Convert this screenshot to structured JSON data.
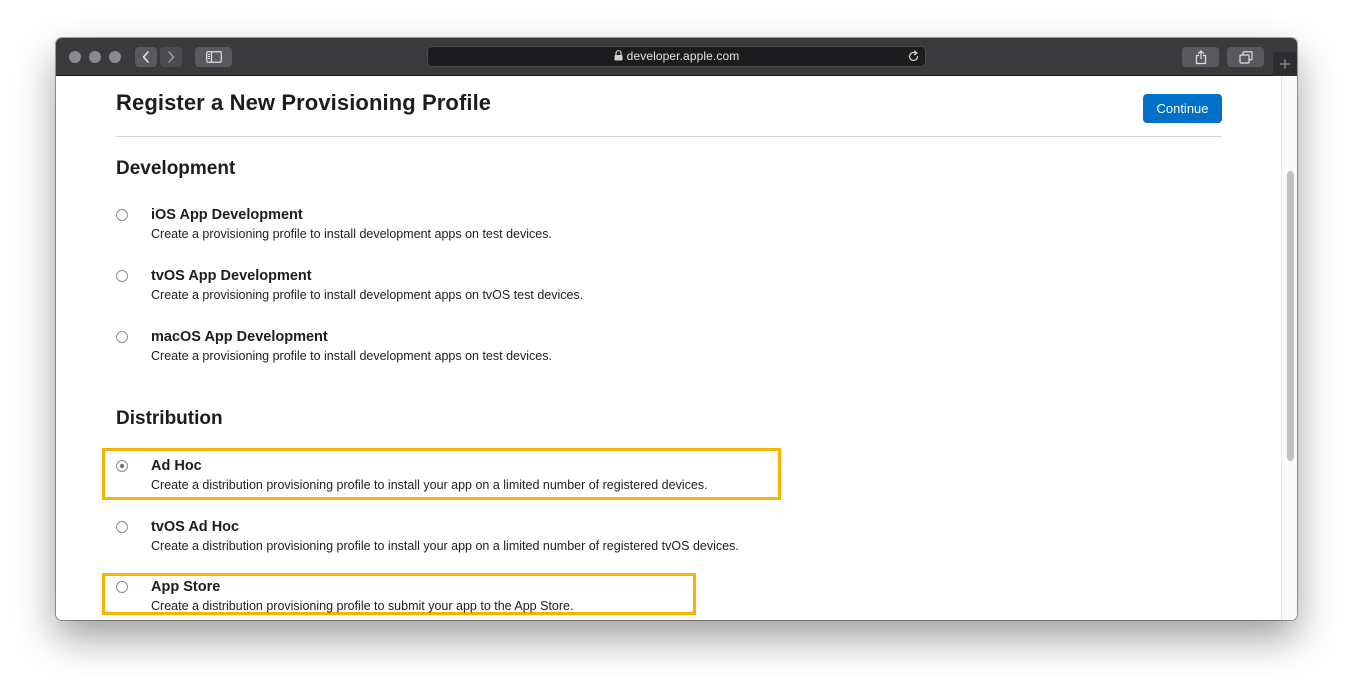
{
  "browser": {
    "address": "developer.apple.com"
  },
  "page": {
    "title": "Register a New Provisioning Profile",
    "continue_label": "Continue"
  },
  "sections": {
    "development": {
      "heading": "Development",
      "options": [
        {
          "title": "iOS App Development",
          "description": "Create a provisioning profile to install development apps on test devices.",
          "selected": false
        },
        {
          "title": "tvOS App Development",
          "description": "Create a provisioning profile to install development apps on tvOS test devices.",
          "selected": false
        },
        {
          "title": "macOS App Development",
          "description": "Create a provisioning profile to install development apps on test devices.",
          "selected": false
        }
      ]
    },
    "distribution": {
      "heading": "Distribution",
      "options": [
        {
          "title": "Ad Hoc",
          "description": "Create a distribution provisioning profile to install your app on a limited number of registered devices.",
          "selected": true
        },
        {
          "title": "tvOS Ad Hoc",
          "description": "Create a distribution provisioning profile to install your app on a limited number of registered tvOS devices.",
          "selected": false
        },
        {
          "title": "App Store",
          "description": "Create a distribution provisioning profile to submit your app to the App Store.",
          "selected": false
        }
      ]
    }
  },
  "colors": {
    "accent": "#0070c9",
    "highlight": "#f5b400",
    "toolbar": "#3a3a3c"
  },
  "icons": {
    "lock": "lock-icon",
    "reload": "reload-icon",
    "share": "share-icon",
    "tabs": "tab-overview-icon",
    "sidebar": "sidebar-icon",
    "back": "chevron-left-icon",
    "forward": "chevron-right-icon",
    "new_tab": "plus-icon"
  }
}
